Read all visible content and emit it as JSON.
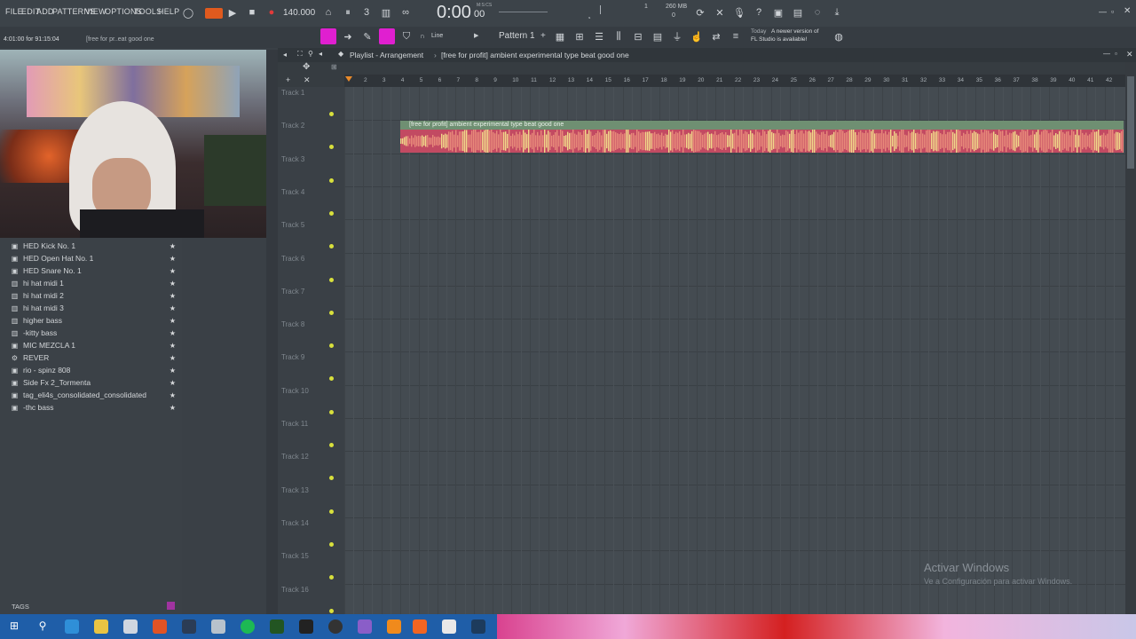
{
  "menu": [
    "FILE",
    "EDIT",
    "ADD",
    "PATTERNS",
    "VIEW",
    "OPTIONS",
    "TOOLS",
    "HELP"
  ],
  "transport": {
    "tempo": "140.000",
    "time": "0:00",
    "time_small": "00",
    "time_label": "M:S:CS",
    "mem": "260 MB",
    "cpu_num": "1",
    "cpu_zero": "0"
  },
  "hint": {
    "time_info": "4:01:00 for 91:15:04",
    "project": "[free for pr..eat good one"
  },
  "toolbar2": {
    "snap": "Line",
    "pattern": "Pattern 1",
    "news_when": "Today",
    "news_text1": "A newer version of",
    "news_text2": "FL Studio is available!"
  },
  "browser": {
    "items": [
      {
        "icon": "plugin",
        "label": "HED Kick No. 1"
      },
      {
        "icon": "plugin",
        "label": "HED Open Hat No. 1"
      },
      {
        "icon": "plugin",
        "label": "HED Snare No. 1"
      },
      {
        "icon": "midi",
        "label": "hi hat midi 1"
      },
      {
        "icon": "midi",
        "label": "hi hat midi 2"
      },
      {
        "icon": "midi",
        "label": "hi hat midi 3"
      },
      {
        "icon": "midi",
        "label": "higher bass"
      },
      {
        "icon": "midi",
        "label": "-kitty bass"
      },
      {
        "icon": "plugin",
        "label": "MIC MEZCLA 1"
      },
      {
        "icon": "gear",
        "label": "REVER"
      },
      {
        "icon": "plugin",
        "label": "rio - spinz 808"
      },
      {
        "icon": "plugin",
        "label": "Side Fx 2_Tormenta"
      },
      {
        "icon": "plugin",
        "label": "tag_eli4s_consolidated_consolidated"
      },
      {
        "icon": "plugin",
        "label": "-thc bass"
      }
    ],
    "tags_label": "TAGS"
  },
  "playlist": {
    "title": "Playlist - Arrangement",
    "breadcrumb": "[free for profit] ambient  experimental type beat good one",
    "tracks": [
      "Track 1",
      "Track 2",
      "Track 3",
      "Track 4",
      "Track 5",
      "Track 6",
      "Track 7",
      "Track 8",
      "Track 9",
      "Track 10",
      "Track 11",
      "Track 12",
      "Track 13",
      "Track 14",
      "Track 15",
      "Track 16"
    ],
    "ruler": [
      "2",
      "3",
      "4",
      "5",
      "6",
      "7",
      "8",
      "9",
      "10",
      "11",
      "12",
      "13",
      "14",
      "15",
      "16",
      "17",
      "18",
      "19",
      "20",
      "21",
      "22",
      "23",
      "24",
      "25",
      "26",
      "27",
      "28",
      "29",
      "30",
      "31",
      "32",
      "33",
      "34",
      "35",
      "36",
      "37",
      "38",
      "39",
      "40",
      "41",
      "42"
    ],
    "clip_label": "[free for profit] ambient  experimental type beat good one"
  },
  "watermark": {
    "line1": "Activar Windows",
    "line2": "Ve a Configuración para activar Windows."
  },
  "colors": {
    "accent": "#e01fd0",
    "clip_head": "#6f8f72",
    "clip_body": "#c24a62",
    "record": "#e23a3a"
  }
}
